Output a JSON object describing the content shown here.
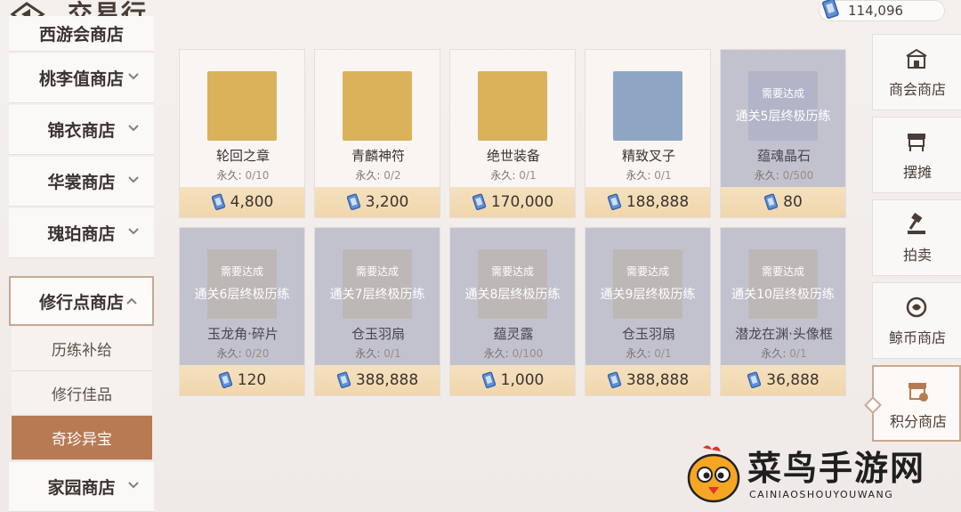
{
  "header": {
    "title": "交易行",
    "currency": "114,096"
  },
  "sidebar": {
    "items": [
      {
        "label": "西游会商店"
      },
      {
        "label": "桃李值商店"
      },
      {
        "label": "锦衣商店"
      },
      {
        "label": "华裳商店"
      },
      {
        "label": "瑰珀商店"
      },
      {
        "label": "修行点商店"
      },
      {
        "label": "家园商店"
      }
    ],
    "subitems": [
      {
        "label": "历练补给"
      },
      {
        "label": "修行佳品"
      },
      {
        "label": "奇珍异宝"
      }
    ]
  },
  "cards": [
    {
      "name": "轮回之章",
      "limit_label": "永久:",
      "limit": "0/10",
      "price": "4,800"
    },
    {
      "name": "青麟神符",
      "limit_label": "永久:",
      "limit": "0/2",
      "price": "3,200"
    },
    {
      "name": "绝世装备",
      "limit_label": "永久:",
      "limit": "0/1",
      "price": "170,000"
    },
    {
      "name": "精致叉子",
      "limit_label": "永久:",
      "limit": "0/1",
      "price": "188,888"
    },
    {
      "name": "蕴魂晶石",
      "limit_label": "永久:",
      "limit": "0/500",
      "price": "80",
      "req1": "需要达成",
      "req2": "通关5层终极历练"
    },
    {
      "name": "玉龙角·碎片",
      "limit_label": "永久:",
      "limit": "0/20",
      "price": "120",
      "req1": "需要达成",
      "req2": "通关6层终极历练"
    },
    {
      "name": "仓玉羽扇",
      "limit_label": "永久:",
      "limit": "0/1",
      "price": "388,888",
      "req1": "需要达成",
      "req2": "通关7层终极历练"
    },
    {
      "name": "蕴灵露",
      "limit_label": "永久:",
      "limit": "0/100",
      "price": "1,000",
      "req1": "需要达成",
      "req2": "通关8层终极历练"
    },
    {
      "name": "仓玉羽扇",
      "limit_label": "永久:",
      "limit": "0/1",
      "price": "388,888",
      "req1": "需要达成",
      "req2": "通关9层终极历练"
    },
    {
      "name": "潜龙在渊·头像框",
      "limit_label": "永久:",
      "limit": "0/1",
      "price": "36,888",
      "req1": "需要达成",
      "req2": "通关10层终极历练"
    }
  ],
  "rightnav": [
    {
      "label": "商会商店",
      "icon": "shop-icon"
    },
    {
      "label": "摆摊",
      "icon": "stall-icon"
    },
    {
      "label": "拍卖",
      "icon": "auction-hammer-icon"
    },
    {
      "label": "鲸币商店",
      "icon": "coin-icon"
    },
    {
      "label": "积分商店",
      "icon": "points-shop-icon"
    }
  ],
  "watermark": {
    "text": "菜鸟手游网",
    "sub": "CAINIAOSHOUYOUWANG"
  },
  "colors": {
    "accent": "#b77a53",
    "price_bar": "#f0d6ac",
    "locked_overlay": "#9698b0"
  }
}
